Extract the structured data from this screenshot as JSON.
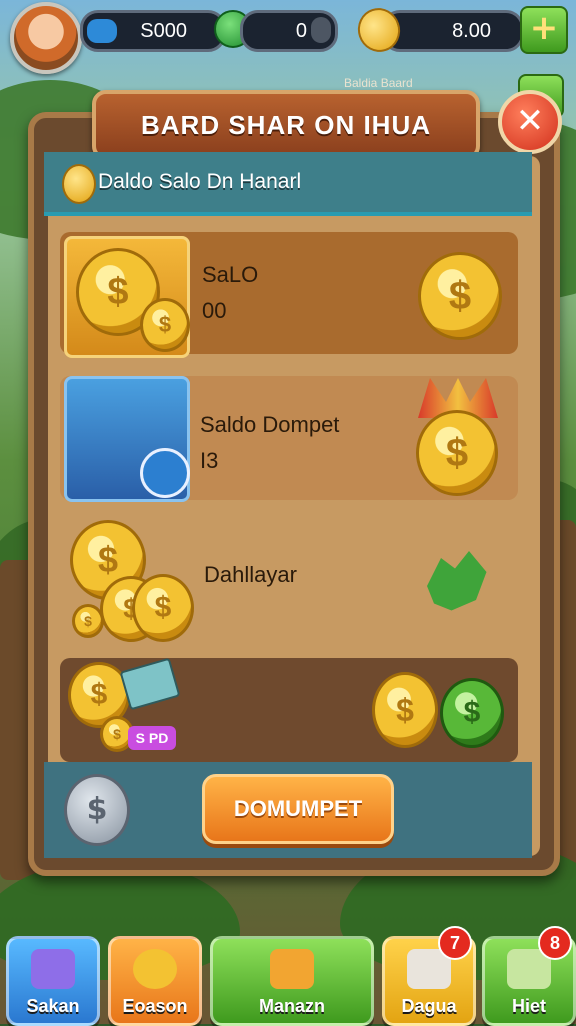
{
  "topbar": {
    "energy_value": "S000",
    "gems_value": "0",
    "coins_value": "8.00",
    "plus_symbol": "+",
    "under_text": "Baldia Baard"
  },
  "dialog": {
    "title": "BARD SHAR ON IHUA",
    "close_symbol": "✕",
    "subheader": "Daldo Salo Dn Hanarl",
    "rows": [
      {
        "title": "SaLO",
        "value": "00"
      },
      {
        "title": "Saldo Dompet",
        "value": "I3"
      },
      {
        "title": "Dahllayar",
        "value": ""
      },
      {
        "tag": "S PD"
      }
    ],
    "action_button": "DOMUMPET",
    "silver_symbol": "$"
  },
  "nav": [
    {
      "label": "Sakan",
      "badge": ""
    },
    {
      "label": "Eoason",
      "badge": ""
    },
    {
      "label": "Manazn",
      "badge": ""
    },
    {
      "label": "Dagua",
      "badge": "7"
    },
    {
      "label": "Hiet",
      "badge": "8"
    }
  ],
  "colors": {
    "panel": "#6b4a2e",
    "accent_orange": "#e8761a",
    "accent_green": "#3f9a1e",
    "close_red": "#d1301c",
    "teal_strip": "#3e7f8a"
  },
  "icons": [
    "avatar",
    "energy-icon",
    "gem-icon",
    "coin-icon",
    "plus-icon",
    "close-icon",
    "treasure-chest-icon",
    "leaf-icon",
    "silver-coin-icon"
  ]
}
